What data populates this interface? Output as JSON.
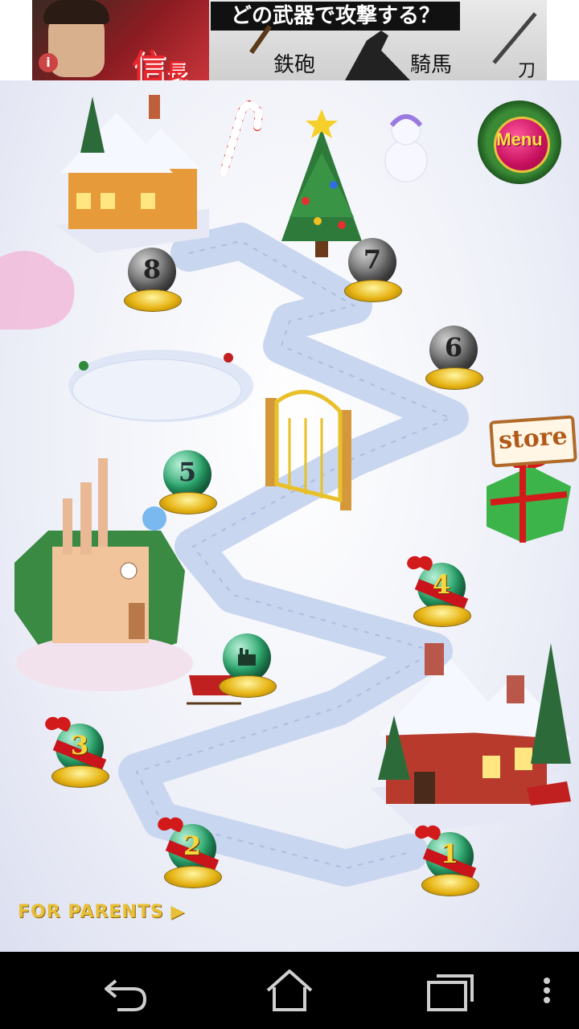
{
  "ad": {
    "headline": "どの武器で攻撃する？",
    "name_main": "信",
    "name_small": "長",
    "options": [
      "鉄砲",
      "騎馬",
      "刀"
    ],
    "info_icon": "i"
  },
  "game": {
    "menu_label": "Menu",
    "store_label": "store",
    "parents_label": "FOR PARENTS ▶",
    "levels": [
      {
        "num": "1",
        "state": "gift"
      },
      {
        "num": "2",
        "state": "gift"
      },
      {
        "num": "3",
        "state": "gift"
      },
      {
        "num": "4",
        "state": "gift"
      },
      {
        "num": "5",
        "state": "green"
      },
      {
        "num": "6",
        "state": "grey"
      },
      {
        "num": "7",
        "state": "grey"
      },
      {
        "num": "8",
        "state": "grey"
      }
    ],
    "bonus_level_icon": "factory-icon"
  },
  "navbar": {
    "back_icon": "back-icon",
    "home_icon": "home-icon",
    "recents_icon": "recents-icon",
    "overflow_icon": "overflow-menu-icon"
  },
  "colors": {
    "path": "#b9c8e8",
    "accent_red": "#c8141a",
    "gold": "#e7b414"
  }
}
